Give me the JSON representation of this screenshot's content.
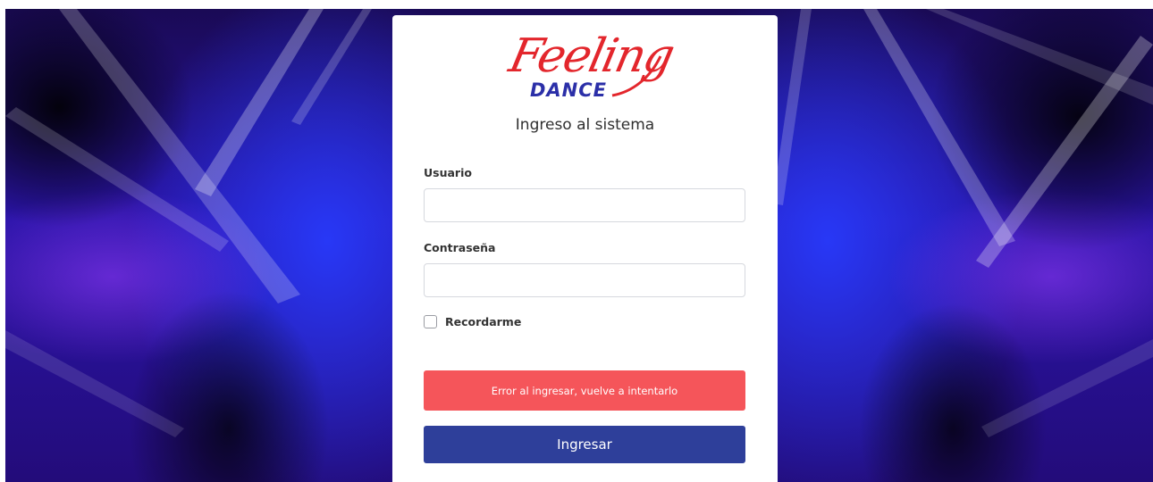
{
  "brand": {
    "logo_script": "Feeling",
    "logo_word": "DANCE"
  },
  "login": {
    "title": "Ingreso al sistema",
    "username_label": "Usuario",
    "username_value": "",
    "password_label": "Contraseña",
    "password_value": "",
    "remember_label": "Recordarme",
    "remember_checked": false,
    "error_message": "Error al ingresar, vuelve a intentarlo",
    "submit_label": "Ingresar"
  },
  "colors": {
    "brand_red": "#e3262c",
    "brand_blue": "#2b2fa8",
    "alert_background": "#f5555a",
    "button_background": "#2e3f9a",
    "backdrop": "#2a14a8"
  }
}
